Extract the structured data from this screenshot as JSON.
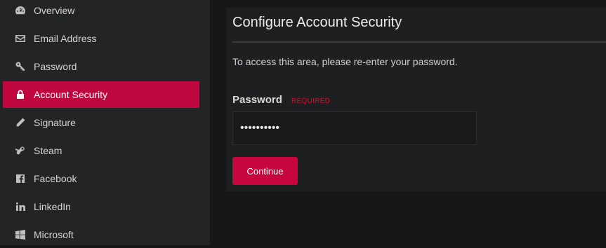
{
  "sidebar": {
    "items": [
      {
        "label": "Overview",
        "icon": "dashboard-icon"
      },
      {
        "label": "Email Address",
        "icon": "envelope-icon"
      },
      {
        "label": "Password",
        "icon": "key-icon"
      },
      {
        "label": "Account Security",
        "icon": "lock-icon",
        "active": true
      },
      {
        "label": "Signature",
        "icon": "pencil-icon"
      },
      {
        "label": "Steam",
        "icon": "steam-icon"
      },
      {
        "label": "Facebook",
        "icon": "facebook-icon"
      },
      {
        "label": "LinkedIn",
        "icon": "linkedin-icon"
      },
      {
        "label": "Microsoft",
        "icon": "windows-icon"
      }
    ]
  },
  "main": {
    "title": "Configure Account Security",
    "description": "To access this area, please re-enter your password.",
    "password_label": "Password",
    "required_tag": "REQUIRED",
    "password_value": "••••••••••",
    "continue_label": "Continue"
  },
  "colors": {
    "accent": "#c0063f",
    "background": "#161719",
    "sidebar": "#232426",
    "panel": "#1e1f21"
  }
}
